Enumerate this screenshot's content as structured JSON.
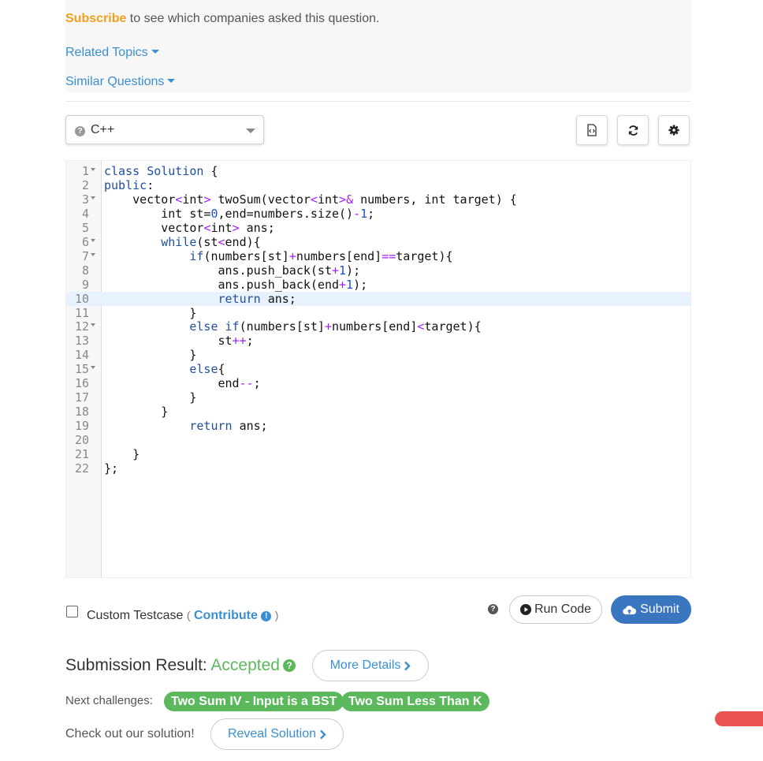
{
  "header": {
    "subscribe_link": "Subscribe",
    "subscribe_text": " to see which companies asked this question.",
    "related_topics": "Related Topics",
    "similar_questions": "Similar Questions"
  },
  "toolbar": {
    "language": "C++",
    "language_help_glyph": "?",
    "buttons": [
      "file-code-icon",
      "refresh-icon",
      "gear-icon"
    ]
  },
  "editor": {
    "active_line": 10,
    "lines": [
      {
        "n": "1",
        "fold": true,
        "code": "class Solution {"
      },
      {
        "n": "2",
        "fold": false,
        "code": "public:"
      },
      {
        "n": "3",
        "fold": true,
        "code": "    vector<int> twoSum(vector<int>& numbers, int target) {"
      },
      {
        "n": "4",
        "fold": false,
        "code": "        int st=0,end=numbers.size()-1;"
      },
      {
        "n": "5",
        "fold": false,
        "code": "        vector<int> ans;"
      },
      {
        "n": "6",
        "fold": true,
        "code": "        while(st<end){"
      },
      {
        "n": "7",
        "fold": true,
        "code": "            if(numbers[st]+numbers[end]==target){"
      },
      {
        "n": "8",
        "fold": false,
        "code": "                ans.push_back(st+1);"
      },
      {
        "n": "9",
        "fold": false,
        "code": "                ans.push_back(end+1);"
      },
      {
        "n": "10",
        "fold": false,
        "code": "                return ans;"
      },
      {
        "n": "11",
        "fold": false,
        "code": "            }"
      },
      {
        "n": "12",
        "fold": true,
        "code": "            else if(numbers[st]+numbers[end]<target){"
      },
      {
        "n": "13",
        "fold": false,
        "code": "                st++;"
      },
      {
        "n": "14",
        "fold": false,
        "code": "            }"
      },
      {
        "n": "15",
        "fold": true,
        "code": "            else{"
      },
      {
        "n": "16",
        "fold": false,
        "code": "                end--;"
      },
      {
        "n": "17",
        "fold": false,
        "code": "            }"
      },
      {
        "n": "18",
        "fold": false,
        "code": "        }"
      },
      {
        "n": "19",
        "fold": false,
        "code": "            return ans;"
      },
      {
        "n": "20",
        "fold": false,
        "code": ""
      },
      {
        "n": "21",
        "fold": false,
        "code": "    }"
      },
      {
        "n": "22",
        "fold": false,
        "code": "};"
      }
    ]
  },
  "actions": {
    "custom_testcase": "Custom Testcase",
    "paren_open": "(",
    "contribute": "Contribute",
    "info_glyph": "!",
    "paren_close": ")",
    "help_glyph": "?",
    "run_code": "Run Code",
    "submit": "Submit"
  },
  "result": {
    "label": "Submission Result: ",
    "status": "Accepted",
    "status_help_glyph": "?",
    "more_details": "More Details",
    "next_challenges_label": "Next challenges:",
    "next_challenges": [
      "Two Sum IV - Input is a BST",
      "Two Sum Less Than K"
    ],
    "check_solution": "Check out our solution!",
    "reveal_solution": "Reveal Solution"
  },
  "colors": {
    "accent": "#3a8fd0",
    "subscribe": "#f0a020",
    "accepted": "#5cb85c",
    "submit": "#3a76c0"
  }
}
